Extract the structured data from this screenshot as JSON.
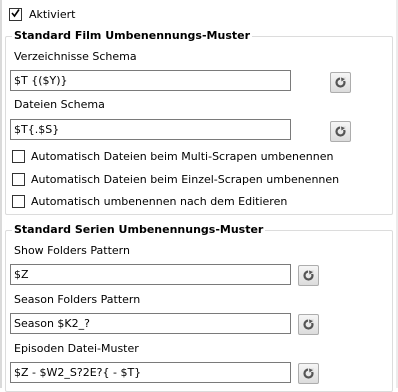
{
  "activated": {
    "label": "Aktiviert",
    "checked": true
  },
  "movie_section": {
    "title": "Standard Film Umbenennungs-Muster",
    "folder_schema": {
      "label": "Verzeichnisse Schema",
      "value": "$T {($Y)}"
    },
    "file_schema": {
      "label": "Dateien Schema",
      "value": "$T{.$S}"
    },
    "options": [
      {
        "label": "Automatisch Dateien beim Multi-Scrapen umbenennen",
        "checked": false
      },
      {
        "label": "Automatisch Dateien beim Einzel-Scrapen umbenennen",
        "checked": false
      },
      {
        "label": "Automatisch umbenennen nach dem Editieren",
        "checked": false
      }
    ]
  },
  "series_section": {
    "title": "Standard Serien Umbenennungs-Muster",
    "show_folders": {
      "label": "Show Folders Pattern",
      "value": "$Z"
    },
    "season_folders": {
      "label": "Season Folders Pattern",
      "value": "Season $K2_?"
    },
    "episode_files": {
      "label": "Episoden Datei-Muster",
      "value": "$Z - $W2_S?2E?{ - $T}"
    }
  },
  "icons": {
    "reset": "reset-icon",
    "check": "checkmark-icon"
  }
}
